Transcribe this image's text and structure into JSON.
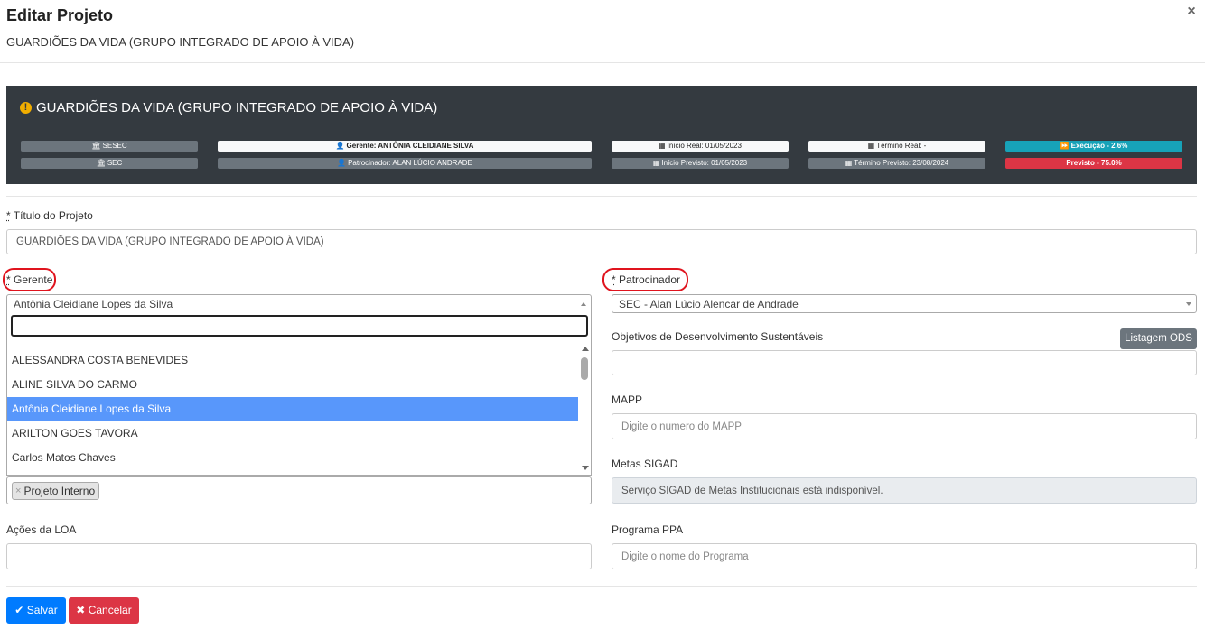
{
  "header": {
    "title": "Editar Projeto",
    "subtitle": "GUARDIÕES DA VIDA (GRUPO INTEGRADO DE APOIO À VIDA)",
    "close_label": "×"
  },
  "summary": {
    "title": "GUARDIÕES DA VIDA (GRUPO INTEGRADO DE APOIO À VIDA)",
    "unit_1": "SESEC",
    "unit_2": "SEC",
    "gerente": "Gerente: ANTÔNIA CLEIDIANE SILVA",
    "patrocinador": "Patrocinador: ALAN LÚCIO ANDRADE",
    "inicio_real": "Início Real: 01/05/2023",
    "inicio_previsto": "Início Previsto: 01/05/2023",
    "termino_real": "Término Real: -",
    "termino_previsto": "Término Previsto: 23/08/2024",
    "execucao": "Execução - 2.6%",
    "previsto": "Previsto - 75.0%",
    "colors": {
      "teal": "#17a2b8",
      "red": "#dc3545",
      "panel": "#343a40"
    }
  },
  "form": {
    "titulo_label": "Título do Projeto",
    "titulo_value": "GUARDIÕES DA VIDA (GRUPO INTEGRADO DE APOIO À VIDA)",
    "required_mark": "*",
    "gerente_label": "Gerente",
    "gerente_value": "Antônia Cleidiane Lopes da Silva",
    "gerente_options": [
      "ALESSANDRA COSTA BENEVIDES",
      "ALINE SILVA DO CARMO",
      "Antônia Cleidiane Lopes da Silva",
      "ARILTON GOES TAVORA",
      "Carlos Matos Chaves"
    ],
    "tag": "Projeto Interno",
    "tag_remove": "×",
    "patrocinador_label": "Patrocinador",
    "patrocinador_value": "SEC - Alan Lúcio Alencar de Andrade",
    "ods_label": "Objetivos de Desenvolvimento Sustentáveis",
    "ods_button": "Listagem ODS",
    "mapp_label": "MAPP",
    "mapp_placeholder": "Digite o numero do MAPP",
    "metas_label": "Metas SIGAD",
    "metas_value": "Serviço SIGAD de Metas Institucionais está indisponível.",
    "acoes_label": "Ações da LOA",
    "ppa_label": "Programa PPA",
    "ppa_placeholder": "Digite o nome do Programa"
  },
  "footer": {
    "save_label": "Salvar",
    "cancel_label": "Cancelar"
  }
}
